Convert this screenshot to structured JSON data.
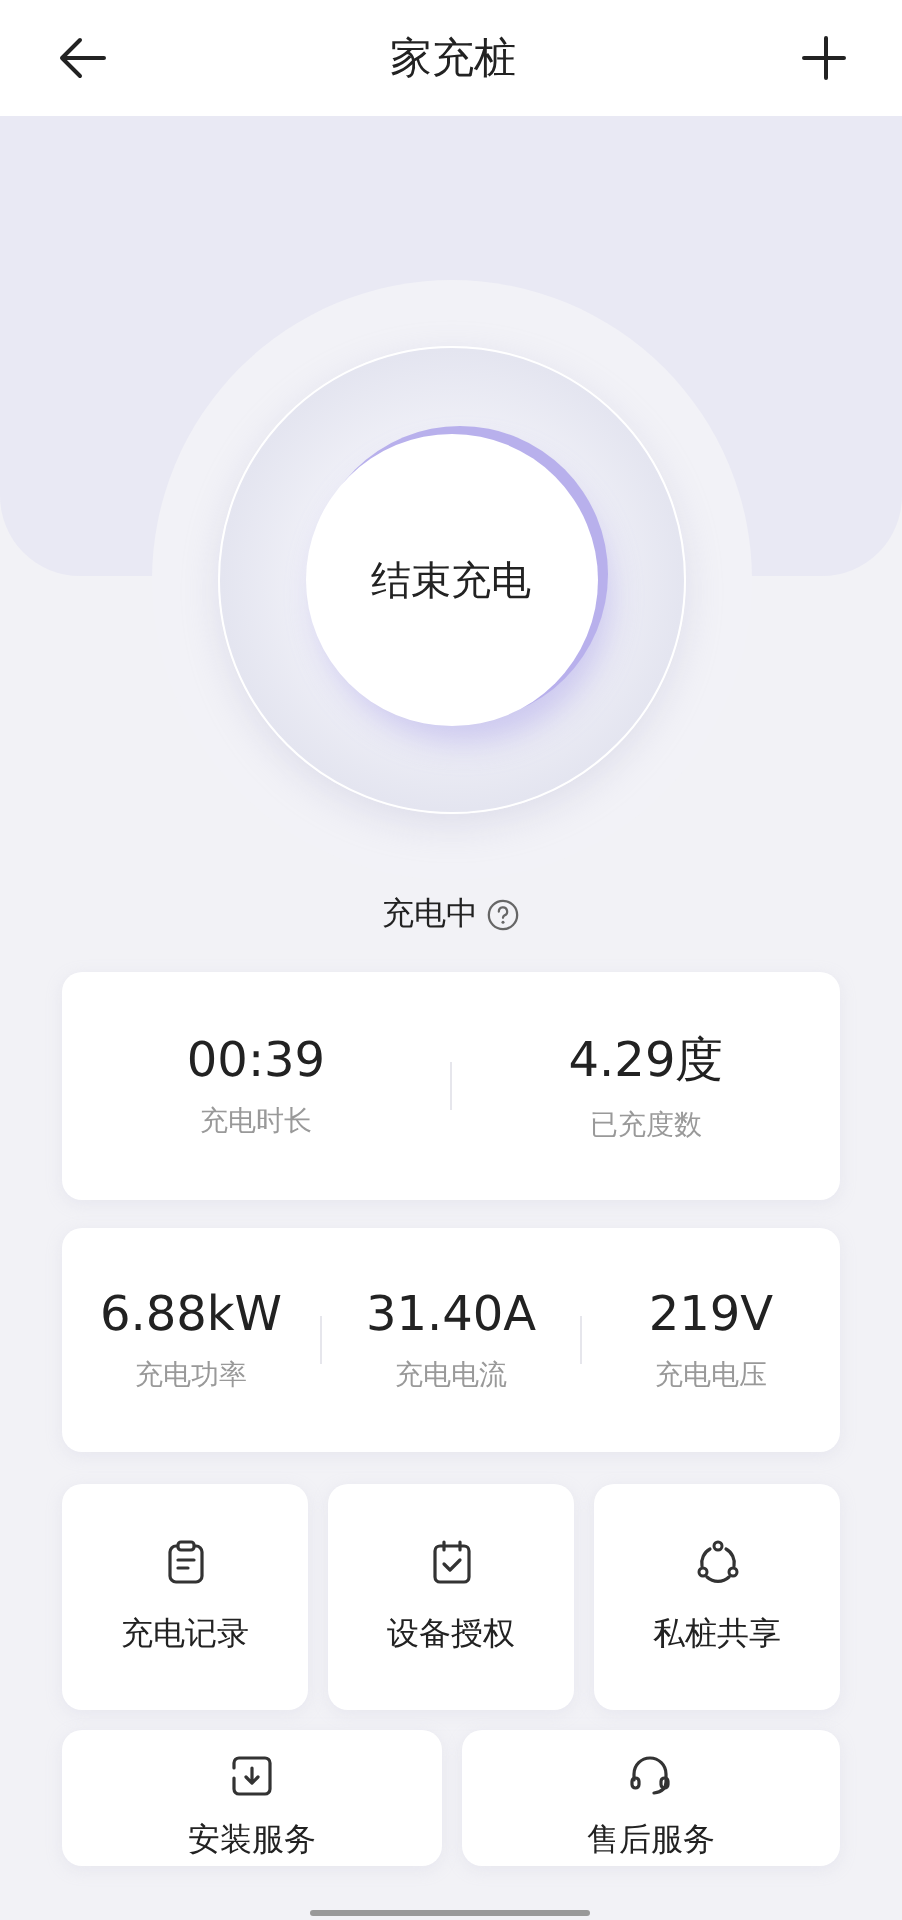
{
  "header": {
    "title": "家充桩"
  },
  "charge_button": {
    "label": "结束充电"
  },
  "status": {
    "text": "充电中"
  },
  "summary": [
    {
      "value": "00:39",
      "label": "充电时长"
    },
    {
      "value": "4.29度",
      "label": "已充度数"
    }
  ],
  "metrics": [
    {
      "value": "6.88kW",
      "label": "充电功率"
    },
    {
      "value": "31.40A",
      "label": "充电电流"
    },
    {
      "value": "219V",
      "label": "充电电压"
    }
  ],
  "services": [
    {
      "label": "充电记录",
      "kind": "record"
    },
    {
      "label": "设备授权",
      "kind": "authorize"
    },
    {
      "label": "私桩共享",
      "kind": "share"
    },
    {
      "label": "安装服务",
      "kind": "install"
    },
    {
      "label": "售后服务",
      "kind": "support"
    }
  ]
}
